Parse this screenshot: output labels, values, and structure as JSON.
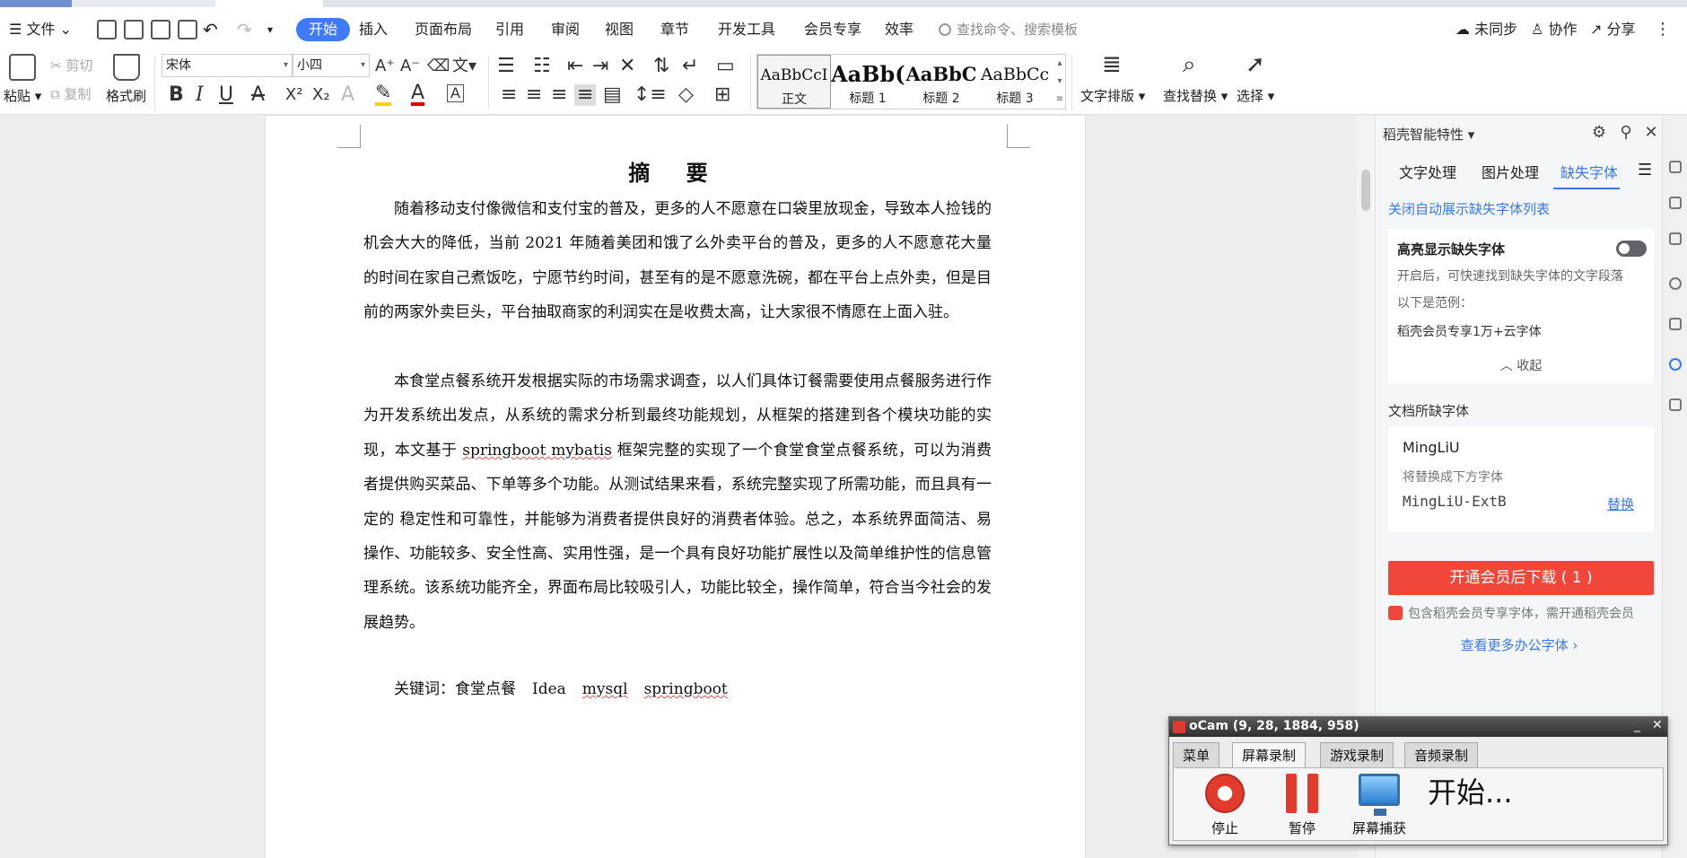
{
  "menubar": {
    "file": "文件",
    "tabs": [
      "开始",
      "插入",
      "页面布局",
      "引用",
      "审阅",
      "视图",
      "章节",
      "开发工具",
      "会员专享",
      "效率"
    ],
    "active_tab": "开始",
    "search_placeholder": "查找命令、搜索模板",
    "sync": "未同步",
    "collab": "协作",
    "share": "分享"
  },
  "ribbon": {
    "paste": "粘贴",
    "cut": "剪切",
    "copy": "复制",
    "format_painter": "格式刷",
    "font_name": "宋体",
    "font_size": "小四",
    "styles": [
      {
        "sample": "AaBbCcI",
        "name": "正文"
      },
      {
        "sample": "AaBb(",
        "name": "标题 1"
      },
      {
        "sample": "AaBbC",
        "name": "标题 2"
      },
      {
        "sample": "AaBbCc",
        "name": "标题 3"
      }
    ],
    "text_layout": "文字排版",
    "find_replace": "查找替换",
    "select": "选择"
  },
  "document": {
    "title": "摘 要",
    "para1": "随着移动支付像微信和支付宝的普及，更多的人不愿意在口袋里放现金，导致本人捡钱的机会大大的降低，当前 2021 年随着美团和饿了么外卖平台的普及，更多的人不愿意花大量的时间在家自己煮饭吃，宁愿节约时间，甚至有的是不愿意洗碗，都在平台上点外卖，但是目前的两家外卖巨头，平台抽取商家的利润实在是收费太高，让大家很不情愿在上面入驻。",
    "para2_a": "本食堂点餐系统开发根据实际的市场需求调查，以人们具体订餐需要使用点餐服务进行作为开发系统出发点，从系统的需求分析到最终功能规划，从框架的搭建到各个模块功能的实现，本文基于 ",
    "para2_link": "springboot mybatis",
    "para2_b": " 框架完整的实现了一个食堂食堂点餐系统，可以为消费者提供购买菜品、下单等多个功能。从测试结果来看，系统完整实现了所需功能，而且具有一定的 稳定性和可靠性，并能够为消费者提供良好的消费者体验。总之，本系统界面简洁、易操作、功能较多、安全性高、实用性强，是一个具有良好功能扩展性以及简单维护性的信息管理系统。该系统功能齐全，界面布局比较吸引人，功能比较全，操作简单，符合当今社会的发展趋势。",
    "keywords_label": "关键词：",
    "keywords": [
      "食堂点餐",
      "Idea",
      "mysql",
      "springboot"
    ]
  },
  "panel": {
    "title": "稻壳智能特性",
    "tabs": [
      "文字处理",
      "图片处理",
      "缺失字体"
    ],
    "active_tab": "缺失字体",
    "close_auto_link": "关闭自动展示缺失字体列表",
    "highlight_title": "高亮显示缺失字体",
    "highlight_desc": "开启后，可快速找到缺失字体的文字段落",
    "example_label": "以下是范例：",
    "example_text": "稻壳会员专享1万+云字体",
    "collapse": "收起",
    "missing_title": "文档所缺字体",
    "missing_font": "MingLiU",
    "replace_hint": "将替换成下方字体",
    "replace_font": "MingLiU-ExtB",
    "replace_link": "替换",
    "download_btn": "开通会员后下载 ( 1 )",
    "member_note": "包含稻壳会员专享字体，需开通稻壳会员",
    "more_fonts": "查看更多办公字体 ›"
  },
  "ocam": {
    "title": "oCam (9, 28, 1884, 958)",
    "tabs": [
      "菜单",
      "屏幕录制",
      "游戏录制",
      "音频录制"
    ],
    "active_tab": "屏幕录制",
    "stop": "停止",
    "pause": "暂停",
    "capture": "屏幕捕获",
    "status": "开始..."
  },
  "colors": {
    "accent": "#3f7bf6",
    "danger": "#f0473a",
    "link": "#3b78e7"
  }
}
